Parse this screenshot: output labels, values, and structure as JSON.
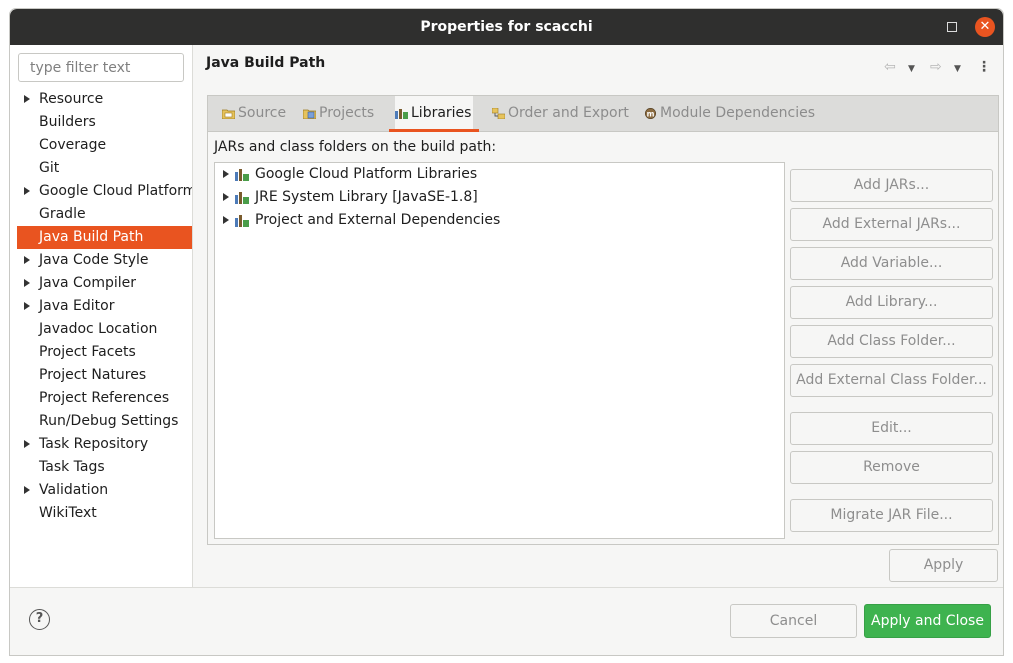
{
  "window": {
    "title": "Properties for scacchi"
  },
  "filter": {
    "placeholder": "type filter text"
  },
  "nav_tree": [
    {
      "label": "Resource",
      "expandable": true
    },
    {
      "label": "Builders",
      "expandable": false
    },
    {
      "label": "Coverage",
      "expandable": false
    },
    {
      "label": "Git",
      "expandable": false
    },
    {
      "label": "Google Cloud Platform",
      "expandable": true
    },
    {
      "label": "Gradle",
      "expandable": false
    },
    {
      "label": "Java Build Path",
      "expandable": false,
      "selected": true
    },
    {
      "label": "Java Code Style",
      "expandable": true
    },
    {
      "label": "Java Compiler",
      "expandable": true
    },
    {
      "label": "Java Editor",
      "expandable": true
    },
    {
      "label": "Javadoc Location",
      "expandable": false
    },
    {
      "label": "Project Facets",
      "expandable": false
    },
    {
      "label": "Project Natures",
      "expandable": false
    },
    {
      "label": "Project References",
      "expandable": false
    },
    {
      "label": "Run/Debug Settings",
      "expandable": false
    },
    {
      "label": "Task Repository",
      "expandable": true
    },
    {
      "label": "Task Tags",
      "expandable": false
    },
    {
      "label": "Validation",
      "expandable": true
    },
    {
      "label": "WikiText",
      "expandable": false
    }
  ],
  "page": {
    "title": "Java Build Path"
  },
  "tabs": [
    {
      "label": "Source",
      "icon": "source-folder-icon"
    },
    {
      "label": "Projects",
      "icon": "projects-folder-icon"
    },
    {
      "label": "Libraries",
      "icon": "libraries-icon",
      "active": true
    },
    {
      "label": "Order and Export",
      "icon": "order-export-icon"
    },
    {
      "label": "Module Dependencies",
      "icon": "module-icon"
    }
  ],
  "libraries": {
    "label": "JARs and class folders on the build path:",
    "items": [
      "Google Cloud Platform Libraries",
      "JRE System Library [JavaSE-1.8]",
      "Project and External Dependencies"
    ]
  },
  "buttons": {
    "add_jars": "Add JARs...",
    "add_external_jars": "Add External JARs...",
    "add_variable": "Add Variable...",
    "add_library": "Add Library...",
    "add_class_folder": "Add Class Folder...",
    "add_external_class_folder": "Add External Class Folder...",
    "edit": "Edit...",
    "remove": "Remove",
    "migrate_jar": "Migrate JAR File...",
    "apply": "Apply",
    "cancel": "Cancel",
    "apply_and_close": "Apply and Close"
  },
  "colors": {
    "accent": "#e95420",
    "ok_button": "#3eb34f",
    "titlebar": "#2f2f2e"
  }
}
